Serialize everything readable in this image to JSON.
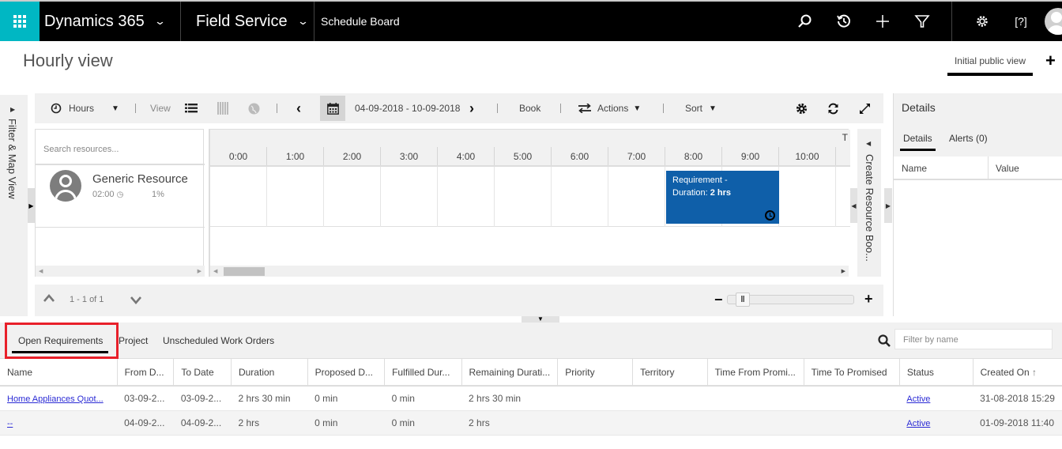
{
  "nav": {
    "app_suite": "Dynamics 365",
    "app_name": "Field Service",
    "area": "Schedule Board",
    "icons": [
      "search-icon",
      "history-icon",
      "add-icon",
      "filter-icon",
      "settings-icon",
      "help-icon",
      "user-avatar"
    ]
  },
  "page": {
    "title": "Hourly view",
    "view_selector": "Initial public view",
    "add_label": "+"
  },
  "left_rail": {
    "label": "Filter & Map View"
  },
  "right_rail": {
    "label": "Create Resource Boo..."
  },
  "toolbar": {
    "timescale": "Hours",
    "view_label": "View",
    "date_range": "04-09-2018 - 10-09-2018",
    "book_label": "Book",
    "actions_label": "Actions",
    "sort_label": "Sort"
  },
  "resources": {
    "search_placeholder": "Search resources...",
    "items": [
      {
        "name": "Generic Resource",
        "time": "02:00",
        "utilization": "1%"
      }
    ],
    "pagination": "1 - 1 of 1"
  },
  "timeline": {
    "hours": [
      "0:00",
      "1:00",
      "2:00",
      "3:00",
      "4:00",
      "5:00",
      "6:00",
      "7:00",
      "8:00",
      "9:00",
      "10:00"
    ],
    "top_marker": "T",
    "booking": {
      "title": "Requirement -",
      "duration_label": "Duration:",
      "duration_value": "2 hrs",
      "color": "#0f5fa9"
    }
  },
  "zoom_slider": {
    "value_fraction": 0.07
  },
  "details": {
    "title": "Details",
    "tabs": [
      "Details",
      "Alerts (0)"
    ],
    "active_tab": "Details",
    "columns": [
      "Name",
      "Value"
    ]
  },
  "requirements": {
    "tabs": [
      "Open Requirements",
      "Project",
      "Unscheduled Work Orders"
    ],
    "active_tab": "Open Requirements",
    "filter_placeholder": "Filter by name",
    "columns": [
      "Name",
      "From D...",
      "To Date",
      "Duration",
      "Proposed D...",
      "Fulfilled Dur...",
      "Remaining Durati...",
      "Priority",
      "Territory",
      "Time From Promi...",
      "Time To Promised",
      "Status",
      "Created On"
    ],
    "sort_column": "Created On",
    "rows": [
      [
        "Home Appliances Quot...",
        "03-09-2...",
        "03-09-2...",
        "2 hrs 30 min",
        "0 min",
        "0 min",
        "2 hrs 30 min",
        "",
        "",
        "",
        "",
        "Active",
        "31-08-2018 15:29"
      ],
      [
        "--",
        "04-09-2...",
        "04-09-2...",
        "2 hrs",
        "0 min",
        "0 min",
        "2 hrs",
        "",
        "",
        "",
        "",
        "Active",
        "01-09-2018 11:40"
      ]
    ]
  },
  "colors": {
    "accent": "#00b7c3",
    "booking": "#0f5fa9",
    "highlight": "#e8202a"
  }
}
